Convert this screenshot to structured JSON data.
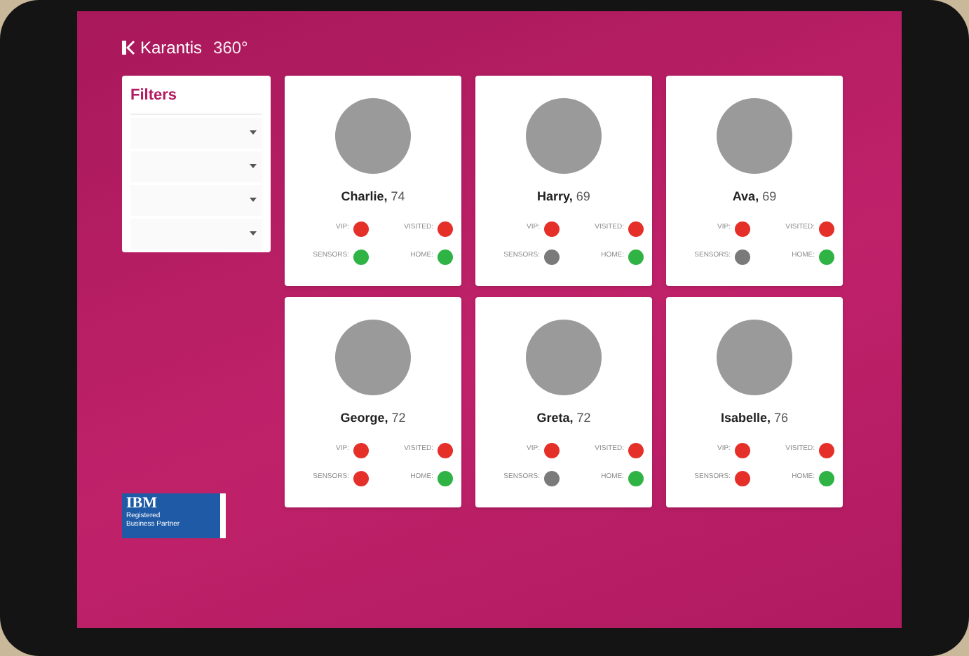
{
  "header": {
    "brand": "Karantis",
    "version": "360°"
  },
  "filters": {
    "title": "Filters",
    "selects": [
      {
        "kind": "dropdown"
      },
      {
        "kind": "dropdown"
      },
      {
        "kind": "dropdown"
      },
      {
        "kind": "dropdown"
      }
    ]
  },
  "residents": [
    {
      "name": "Charlie,",
      "age": "74",
      "statuses": [
        {
          "label": "VIP:",
          "color": "#e5302a"
        },
        {
          "label": "VISITED:",
          "color": "#e5302a"
        },
        {
          "label": "SENSORS:",
          "color": "#2fb344"
        },
        {
          "label": "HOME:",
          "color": "#2fb344"
        }
      ]
    },
    {
      "name": "Harry,",
      "age": "69",
      "statuses": [
        {
          "label": "VIP:",
          "color": "#e5302a"
        },
        {
          "label": "VISITED:",
          "color": "#e5302a"
        },
        {
          "label": "SENSORS:",
          "color": "#7a7a7a"
        },
        {
          "label": "HOME:",
          "color": "#2fb344"
        }
      ]
    },
    {
      "name": "Ava,",
      "age": "69",
      "statuses": [
        {
          "label": "VIP:",
          "color": "#e5302a"
        },
        {
          "label": "VISITED:",
          "color": "#e5302a"
        },
        {
          "label": "SENSORS:",
          "color": "#7a7a7a"
        },
        {
          "label": "HOME:",
          "color": "#2fb344"
        }
      ]
    },
    {
      "name": "George,",
      "age": "72",
      "statuses": [
        {
          "label": "VIP:",
          "color": "#e5302a"
        },
        {
          "label": "VISITED:",
          "color": "#e5302a"
        },
        {
          "label": "SENSORS:",
          "color": "#e5302a"
        },
        {
          "label": "HOME:",
          "color": "#2fb344"
        }
      ]
    },
    {
      "name": "Greta,",
      "age": "72",
      "statuses": [
        {
          "label": "VIP:",
          "color": "#e5302a"
        },
        {
          "label": "VISITED:",
          "color": "#e5302a"
        },
        {
          "label": "SENSORS:",
          "color": "#7a7a7a"
        },
        {
          "label": "HOME:",
          "color": "#2fb344"
        }
      ]
    },
    {
      "name": "Isabelle,",
      "age": "76",
      "statuses": [
        {
          "label": "VIP:",
          "color": "#e5302a"
        },
        {
          "label": "VISITED:",
          "color": "#e5302a"
        },
        {
          "label": "SENSORS:",
          "color": "#e5302a"
        },
        {
          "label": "HOME:",
          "color": "#2fb344"
        }
      ]
    }
  ],
  "partner_badge": {
    "logo": "IBM",
    "caption": "Registered Business Partner"
  }
}
